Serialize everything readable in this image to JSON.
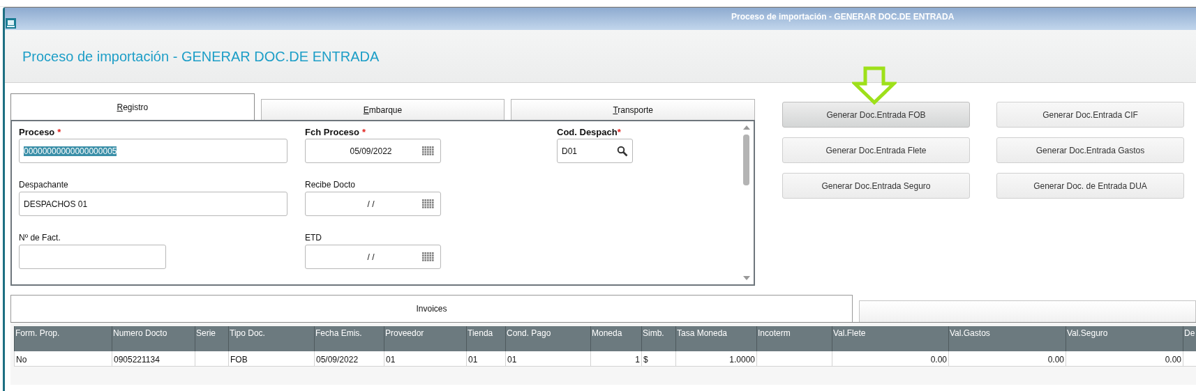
{
  "window": {
    "title": "Proceso de importación - GENERAR DOC.DE ENTRADA"
  },
  "heading": "Proceso de importación - GENERAR DOC.DE ENTRADA",
  "tabs": [
    {
      "label": "Registro",
      "selected": true
    },
    {
      "label": "Embarque",
      "selected": false
    },
    {
      "label": "Transporte",
      "selected": false
    }
  ],
  "fields": [
    {
      "label": "Proceso",
      "required_mark": "*",
      "kind": "text",
      "value": "00000000000000000005",
      "value_selected": true
    },
    {
      "label": "Fch Proceso",
      "required_mark": "*",
      "kind": "date",
      "value": "05/09/2022"
    },
    {
      "label": "Cod. Despach",
      "required_mark": "*",
      "kind": "lookup",
      "value": "D01"
    },
    {
      "label": "Despachante",
      "kind": "text",
      "value": "DESPACHOS 01"
    },
    {
      "label": "Recibe Docto",
      "kind": "date",
      "value": "/ /"
    },
    {
      "label": "Nº de Fact.",
      "kind": "short"
    },
    {
      "label": "ETD",
      "kind": "date",
      "value": "/ /"
    }
  ],
  "buttons": [
    {
      "label": "Generar Doc.Entrada FOB",
      "highlighted": true
    },
    {
      "label": "Generar Doc.Entrada CIF",
      "highlighted": false
    },
    {
      "label": "Generar Doc.Entrada Flete",
      "highlighted": false
    },
    {
      "label": "Generar Doc.Entrada Gastos",
      "highlighted": false
    },
    {
      "label": "Generar Doc.Entrada Seguro",
      "highlighted": false
    },
    {
      "label": "Generar Doc. de Entrada DUA",
      "highlighted": false
    }
  ],
  "bottom_tabs": [
    {
      "label": "Invoices",
      "selected": true
    },
    {
      "selected": false
    }
  ],
  "table": {
    "columns": [
      {
        "label": "Form. Prop.",
        "numeric": false
      },
      {
        "label": "Numero Docto",
        "numeric": false
      },
      {
        "label": "Serie"
      },
      {
        "label": "Tipo Doc.",
        "numeric": false
      },
      {
        "label": "Fecha Emis.",
        "numeric": false
      },
      {
        "label": "Proveedor",
        "numeric": false
      },
      {
        "label": "Tienda",
        "numeric": false
      },
      {
        "label": "Cond. Pago",
        "numeric": false
      },
      {
        "label": "Moneda",
        "numeric": true
      },
      {
        "label": "Simb.",
        "numeric": false
      },
      {
        "label": "Tasa Moneda",
        "numeric": true
      },
      {
        "label": "Incoterm"
      },
      {
        "label": "Val.Flete",
        "numeric": true
      },
      {
        "label": "Val.Gastos",
        "numeric": true
      },
      {
        "label": "Val.Seguro",
        "numeric": true
      },
      {
        "label": "De"
      }
    ],
    "rows": [
      [
        "No",
        "0905221134",
        "",
        "FOB",
        "05/09/2022",
        "01",
        "01",
        "01",
        "1",
        "$",
        "1.0000",
        "",
        "0.00",
        "0.00",
        "0.00",
        ""
      ]
    ]
  }
}
